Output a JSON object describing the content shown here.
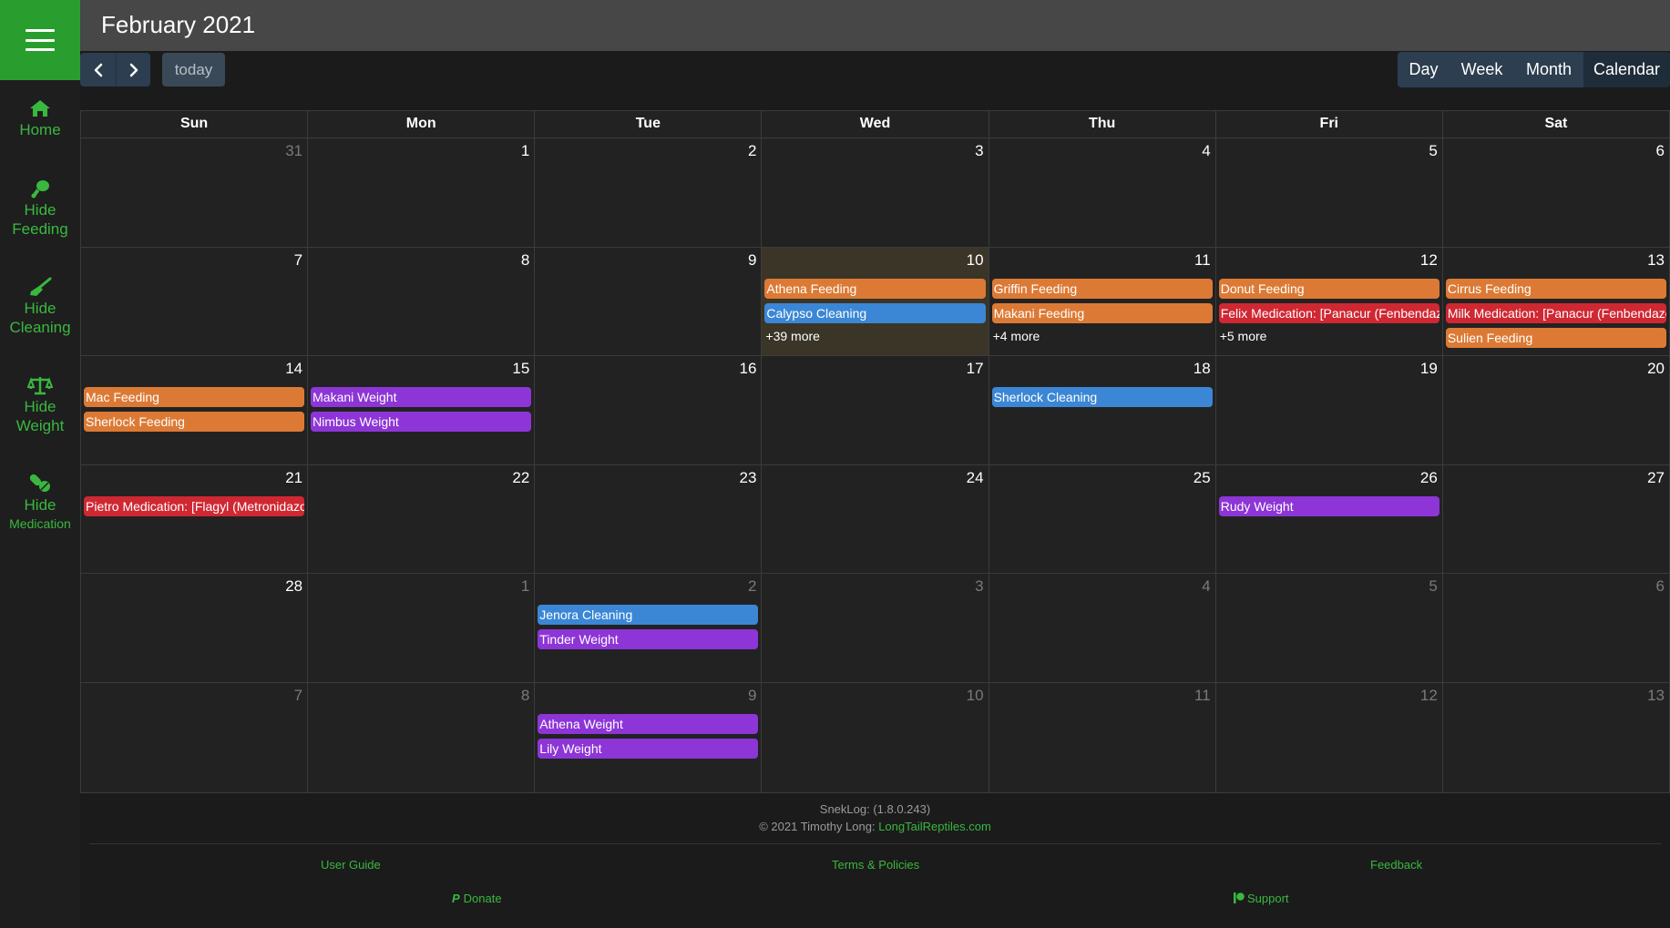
{
  "header": {
    "title": "February 2021"
  },
  "sidebar": {
    "items": [
      {
        "line1": "Home",
        "line2": ""
      },
      {
        "line1": "Hide",
        "line2": "Feeding"
      },
      {
        "line1": "Hide",
        "line2": "Cleaning"
      },
      {
        "line1": "Hide",
        "line2": "Weight"
      },
      {
        "line1": "Hide",
        "line2": "Medication"
      }
    ]
  },
  "toolbar": {
    "today_label": "today",
    "views": [
      "Day",
      "Week",
      "Month",
      "Calendar"
    ],
    "active_view": "Calendar"
  },
  "calendar": {
    "weekdays": [
      "Sun",
      "Mon",
      "Tue",
      "Wed",
      "Thu",
      "Fri",
      "Sat"
    ],
    "weeks": [
      [
        {
          "num": "31",
          "other": true,
          "events": []
        },
        {
          "num": "1",
          "events": []
        },
        {
          "num": "2",
          "events": []
        },
        {
          "num": "3",
          "events": []
        },
        {
          "num": "4",
          "events": []
        },
        {
          "num": "5",
          "events": []
        },
        {
          "num": "6",
          "events": []
        }
      ],
      [
        {
          "num": "7",
          "events": []
        },
        {
          "num": "8",
          "events": []
        },
        {
          "num": "9",
          "events": []
        },
        {
          "num": "10",
          "today": true,
          "events": [
            {
              "title": "Athena Feeding",
              "type": "feeding"
            },
            {
              "title": "Calypso Cleaning",
              "type": "cleaning"
            }
          ],
          "more": "+39 more"
        },
        {
          "num": "11",
          "events": [
            {
              "title": "Griffin Feeding",
              "type": "feeding"
            },
            {
              "title": "Makani Feeding",
              "type": "feeding"
            }
          ],
          "more": "+4 more"
        },
        {
          "num": "12",
          "events": [
            {
              "title": "Donut Feeding",
              "type": "feeding"
            },
            {
              "title": "Felix Medication: [Panacur (Fenbendazole)]",
              "type": "medication"
            }
          ],
          "more": "+5 more"
        },
        {
          "num": "13",
          "events": [
            {
              "title": "Cirrus Feeding",
              "type": "feeding"
            },
            {
              "title": "Milk Medication: [Panacur (Fenbendazole)]",
              "type": "medication"
            },
            {
              "title": "Sulien Feeding",
              "type": "feeding"
            }
          ]
        }
      ],
      [
        {
          "num": "14",
          "events": [
            {
              "title": "Mac Feeding",
              "type": "feeding"
            },
            {
              "title": "Sherlock Feeding",
              "type": "feeding"
            }
          ]
        },
        {
          "num": "15",
          "events": [
            {
              "title": "Makani Weight",
              "type": "weight"
            },
            {
              "title": "Nimbus Weight",
              "type": "weight"
            }
          ]
        },
        {
          "num": "16",
          "events": []
        },
        {
          "num": "17",
          "events": []
        },
        {
          "num": "18",
          "events": [
            {
              "title": "Sherlock Cleaning",
              "type": "cleaning"
            }
          ]
        },
        {
          "num": "19",
          "events": []
        },
        {
          "num": "20",
          "events": []
        }
      ],
      [
        {
          "num": "21",
          "events": [
            {
              "title": "Pietro Medication: [Flagyl (Metronidazole)]",
              "type": "medication"
            }
          ]
        },
        {
          "num": "22",
          "events": []
        },
        {
          "num": "23",
          "events": []
        },
        {
          "num": "24",
          "events": []
        },
        {
          "num": "25",
          "events": []
        },
        {
          "num": "26",
          "events": [
            {
              "title": "Rudy Weight",
              "type": "weight"
            }
          ]
        },
        {
          "num": "27",
          "events": []
        }
      ],
      [
        {
          "num": "28",
          "events": []
        },
        {
          "num": "1",
          "other": true,
          "events": []
        },
        {
          "num": "2",
          "other": true,
          "events": [
            {
              "title": "Jenora Cleaning",
              "type": "cleaning"
            },
            {
              "title": "Tinder Weight",
              "type": "weight"
            }
          ]
        },
        {
          "num": "3",
          "other": true,
          "events": []
        },
        {
          "num": "4",
          "other": true,
          "events": []
        },
        {
          "num": "5",
          "other": true,
          "events": []
        },
        {
          "num": "6",
          "other": true,
          "events": []
        }
      ],
      [
        {
          "num": "7",
          "other": true,
          "events": []
        },
        {
          "num": "8",
          "other": true,
          "events": []
        },
        {
          "num": "9",
          "other": true,
          "events": [
            {
              "title": "Athena Weight",
              "type": "weight"
            },
            {
              "title": "Lily Weight",
              "type": "weight"
            }
          ]
        },
        {
          "num": "10",
          "other": true,
          "events": []
        },
        {
          "num": "11",
          "other": true,
          "events": []
        },
        {
          "num": "12",
          "other": true,
          "events": []
        },
        {
          "num": "13",
          "other": true,
          "events": []
        }
      ]
    ]
  },
  "footer": {
    "version": "SnekLog: (1.8.0.243)",
    "copyright_prefix": "© 2021 Timothy Long: ",
    "copyright_link": "LongTailReptiles.com",
    "user_guide": "User Guide",
    "terms": "Terms & Policies",
    "feedback": "Feedback",
    "donate": "Donate",
    "support": "Support"
  },
  "colors": {
    "accent": "#2a9d2f",
    "feeding": "#dc7a35",
    "cleaning": "#3b87d6",
    "weight": "#8d35d6",
    "medication": "#cf2832"
  }
}
